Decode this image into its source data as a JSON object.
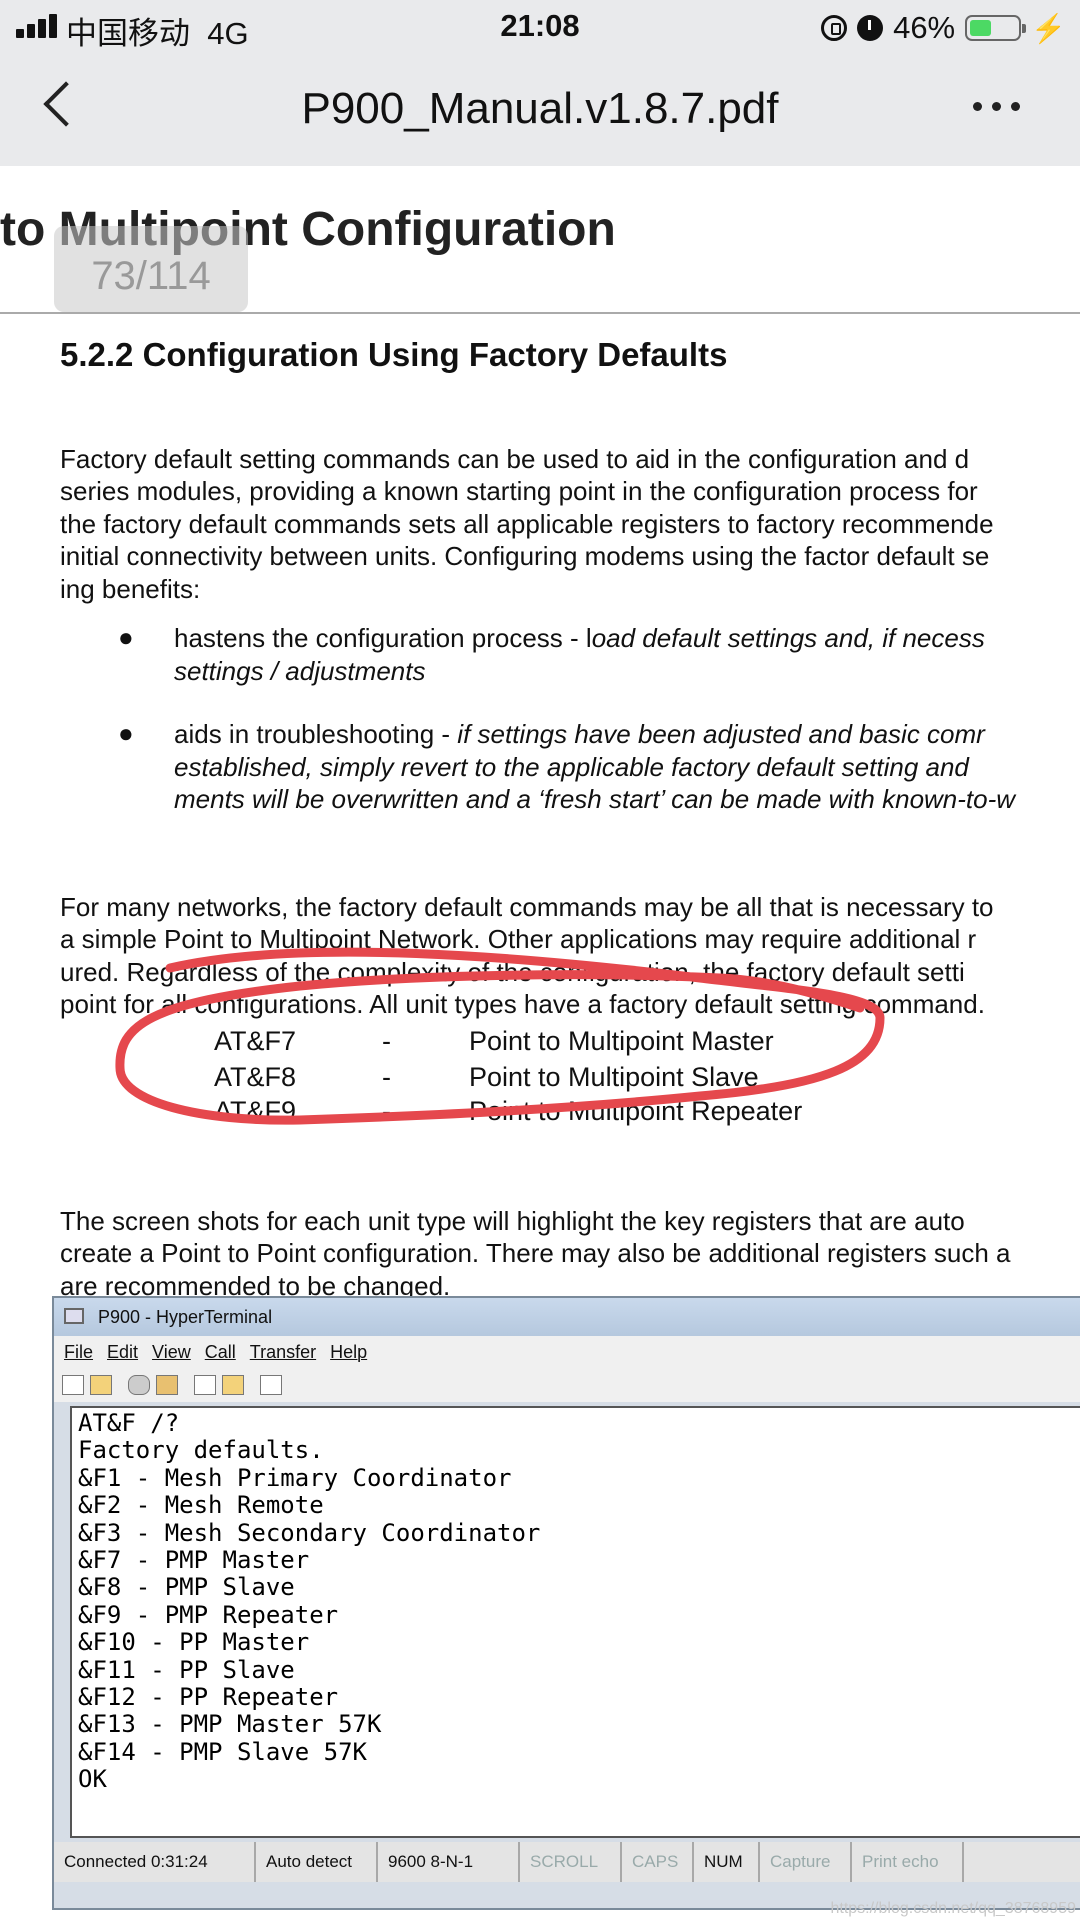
{
  "status_bar": {
    "carrier": "中国移动",
    "network": "4G",
    "time": "21:08",
    "battery": "46%",
    "battery_level": 0.46,
    "icons": [
      "signal-icon",
      "rotation-lock-icon",
      "alarm-icon",
      "battery-icon",
      "charging-icon"
    ]
  },
  "nav": {
    "back_icon": "chevron-left-icon",
    "title": "P900_Manual.v1.8.7.pdf",
    "more_icon": "more-icon"
  },
  "document": {
    "header": "to Multipoint Configuration",
    "page_indicator": "73/114",
    "section_title": "5.2.2  Configuration Using Factory Defaults",
    "intro_lines": [
      "Factory default setting commands can be used to aid in the configuration and d",
      "series modules, providing a known starting point in the configuration process for",
      "the factory default commands sets all applicable registers to factory recommende",
      "initial connectivity between units. Configuring modems using the factor default se",
      "ing benefits:"
    ],
    "bullets": [
      {
        "lead": "hastens the configuration process - l",
        "italic_lines": [
          "oad default settings and, if necess",
          "settings / adjustments"
        ]
      },
      {
        "lead": "aids in troubleshooting - ",
        "italic_lines": [
          "if settings have been adjusted and basic comr",
          "established, simply revert to the applicable factory default setting and",
          "ments will be overwritten and a ‘fresh start’ can be made with known-to-w"
        ]
      }
    ],
    "networks_lines": [
      "For many networks, the factory default commands may be all that is necessary to",
      "a simple Point to Multipoint Network. Other applications may require additional r",
      "ured. Regardless of the complexity of the configuration, the factory default setti",
      "point for all configurations. All unit types have a factory default setting command."
    ],
    "commands": [
      {
        "code": "AT&F7",
        "dash": "-",
        "desc": "Point to Multipoint Master"
      },
      {
        "code": "AT&F8",
        "dash": "-",
        "desc": "Point to Multipoint Slave"
      },
      {
        "code": "AT&F9",
        "dash": "-",
        "desc": "Point to Multipoint Repeater"
      }
    ],
    "screens_lines": [
      "The screen shots for each unit type will highlight the key registers that are auto",
      "create a Point to Point configuration. There may also be additional registers such a",
      "are recommended to be changed."
    ]
  },
  "hyperterminal": {
    "title": "P900 - HyperTerminal",
    "menu": [
      "File",
      "Edit",
      "View",
      "Call",
      "Transfer",
      "Help"
    ],
    "toolbar_icons": [
      "new-icon",
      "open-icon",
      "phone-icon",
      "disconnect-icon",
      "send-icon",
      "receive-icon",
      "properties-icon"
    ],
    "terminal_lines": [
      "AT&F /?",
      "Factory defaults.",
      "&F1 - Mesh Primary Coordinator",
      "&F2 - Mesh Remote",
      "&F3 - Mesh Secondary Coordinator",
      "&F7 - PMP Master",
      "&F8 - PMP Slave",
      "&F9 - PMP Repeater",
      "&F10 - PP Master",
      "&F11 - PP Slave",
      "&F12 - PP Repeater",
      "&F13 - PMP Master 57K",
      "&F14 - PMP Slave 57K",
      "OK"
    ],
    "status": [
      "Connected 0:31:24",
      "Auto detect",
      "9600 8-N-1",
      "SCROLL",
      "CAPS",
      "NUM",
      "Capture",
      "Print echo"
    ]
  },
  "watermark": "https://blog.csdn.net/qq_38768959",
  "highlight_color": "#e5484d"
}
